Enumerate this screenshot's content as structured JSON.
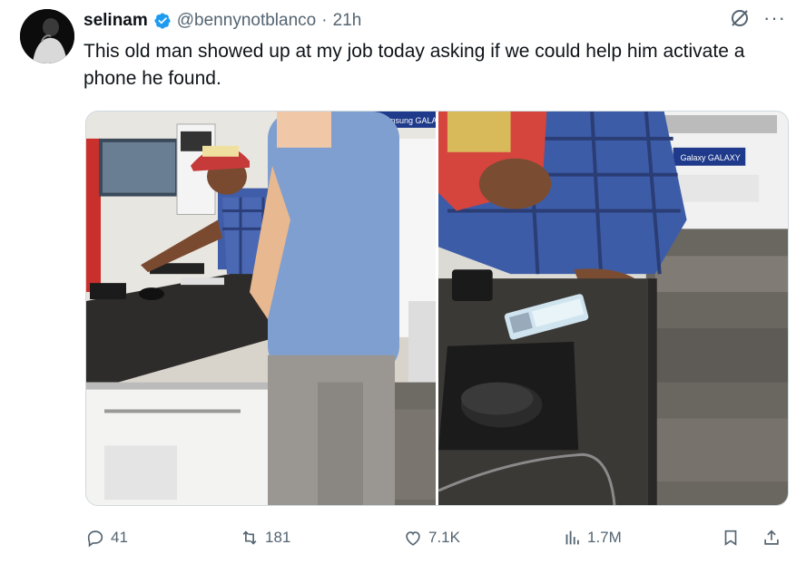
{
  "tweet": {
    "author_name": "selinam",
    "handle": "@bennynotblanco",
    "separator": "·",
    "time": "21h",
    "text": "This old man showed up at my job today asking if we could help him activate a phone he found."
  },
  "icons": {
    "verified": "verified-badge-icon",
    "grok": "grok-icon",
    "more": "more-icon",
    "reply": "reply-icon",
    "retweet": "retweet-icon",
    "like": "like-icon",
    "views": "views-icon",
    "bookmark": "bookmark-icon",
    "share": "share-icon"
  },
  "media": {
    "left_sign": "Samsung GALA",
    "right_sign": "Galaxy GALAXY"
  },
  "actions": {
    "replies": "41",
    "retweets": "181",
    "likes": "7.1K",
    "views": "1.7M"
  },
  "colors": {
    "verified": "#1d9bf0",
    "text_secondary": "#536471"
  }
}
